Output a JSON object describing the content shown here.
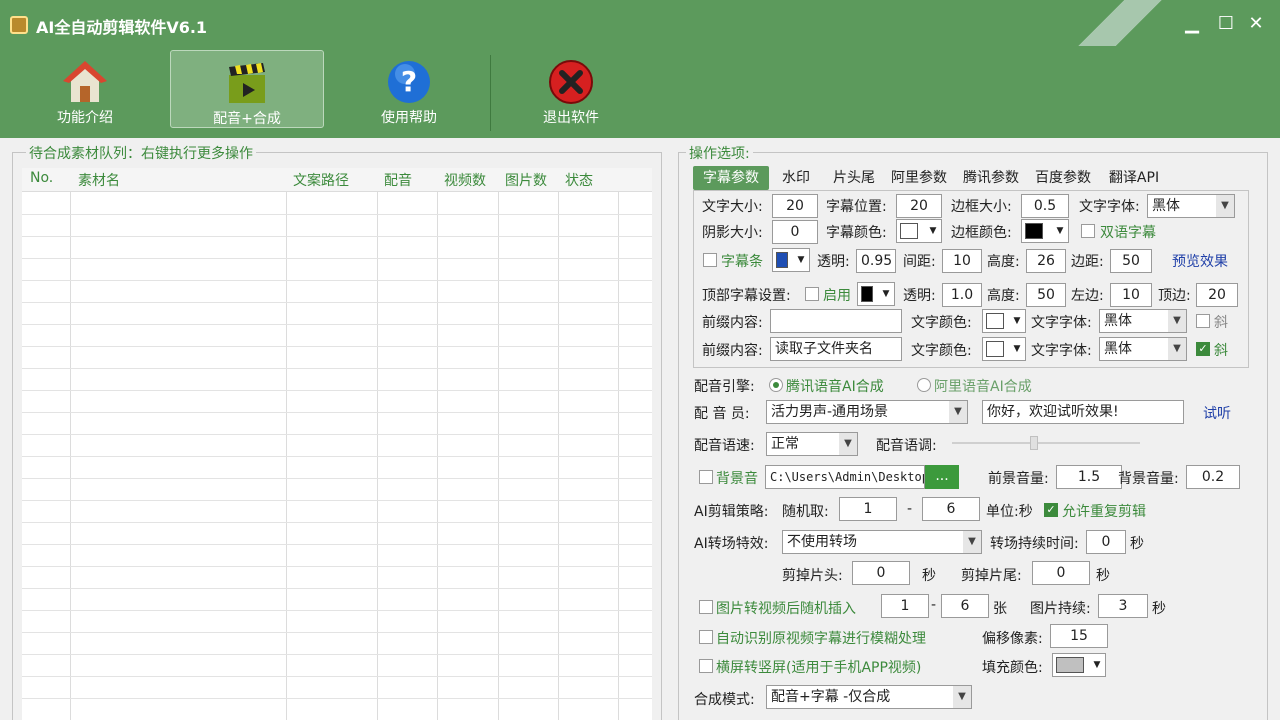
{
  "window": {
    "title": "AI全自动剪辑软件V6.1",
    "minimize": "▁",
    "maximize": "☐",
    "close": "✕"
  },
  "toolbar": {
    "intro": "功能介绍",
    "compose": "配音+合成",
    "help": "使用帮助",
    "exit": "退出软件"
  },
  "queue": {
    "title": "待合成素材队列：右键执行更多操作",
    "columns": [
      "No.",
      "素材名",
      "文案路径",
      "配音",
      "视频数",
      "图片数",
      "状态"
    ]
  },
  "options": {
    "title": "操作选项:",
    "tabs": [
      "字幕参数",
      "水印",
      "片头尾",
      "阿里参数",
      "腾讯参数",
      "百度参数",
      "翻译API"
    ],
    "subtitle": {
      "font_size_label": "文字大小:",
      "font_size": "20",
      "position_label": "字幕位置:",
      "position": "20",
      "border_size_label": "边框大小:",
      "border_size": "0.5",
      "font_label": "文字字体:",
      "font": "黑体",
      "shadow_label": "阴影大小:",
      "shadow": "0",
      "color_label": "字幕颜色:",
      "border_color_label": "边框颜色:",
      "dual_label": "双语字幕",
      "bar_label": "字幕条",
      "opacity_label": "透明:",
      "opacity": "0.95",
      "spacing_label": "间距:",
      "spacing": "10",
      "height_label": "高度:",
      "height": "26",
      "margin_label": "边距:",
      "margin": "50",
      "preview": "预览效果",
      "top_label": "顶部字幕设置:",
      "top_enable": "启用",
      "top_opacity_label": "透明:",
      "top_opacity": "1.0",
      "top_height_label": "高度:",
      "top_height": "50",
      "top_left_label": "左边:",
      "top_left": "10",
      "top_top_label": "顶边:",
      "top_top": "20",
      "prefix1_label": "前缀内容:",
      "prefix1": "",
      "prefix_color_label": "文字颜色:",
      "prefix_font_label": "文字字体:",
      "prefix_font": "黑体",
      "italic": "斜",
      "prefix2_label": "前缀内容:",
      "prefix2": "读取子文件夹名"
    },
    "engine_label": "配音引擎:",
    "engine_tencent": "腾讯语音AI合成",
    "engine_ali": "阿里语音AI合成",
    "voice_label": "配 音 员:",
    "voice": "活力男声-通用场景",
    "test_text": "你好，欢迎试听效果!",
    "listen": "试听",
    "speed_label": "配音语速:",
    "speed": "正常",
    "tone_label": "配音语调:",
    "bgm_label": "背景音",
    "bgm_path": "C:\\Users\\Admin\\Desktop",
    "browse": "...",
    "fg_vol_label": "前景音量:",
    "fg_vol": "1.5",
    "bg_vol_label": "背景音量:",
    "bg_vol": "0.2",
    "ai_strategy_label": "AI剪辑策略:",
    "random_label": "随机取:",
    "rand_min": "1",
    "dash": "-",
    "rand_max": "6",
    "unit_label": "单位:秒",
    "allow_repeat": "允许重复剪辑",
    "transition_label": "AI转场特效:",
    "transition": "不使用转场",
    "trans_dur_label": "转场持续时间:",
    "trans_dur": "0",
    "sec": "秒",
    "cut_head_label": "剪掉片头:",
    "cut_head": "0",
    "cut_tail_label": "剪掉片尾:",
    "cut_tail": "0",
    "img_insert_label": "图片转视频后随机插入",
    "img_min": "1",
    "img_max": "6",
    "img_unit": "张",
    "img_dur_label": "图片持续:",
    "img_dur": "3",
    "blur_label": "自动识别原视频字幕进行模糊处理",
    "offset_label": "偏移像素:",
    "offset": "15",
    "landscape_label": "横屏转竖屏(适用于手机APP视频)",
    "fill_label": "填充颜色:",
    "mode_label": "合成模式:",
    "mode": "配音+字幕 -仅合成"
  }
}
